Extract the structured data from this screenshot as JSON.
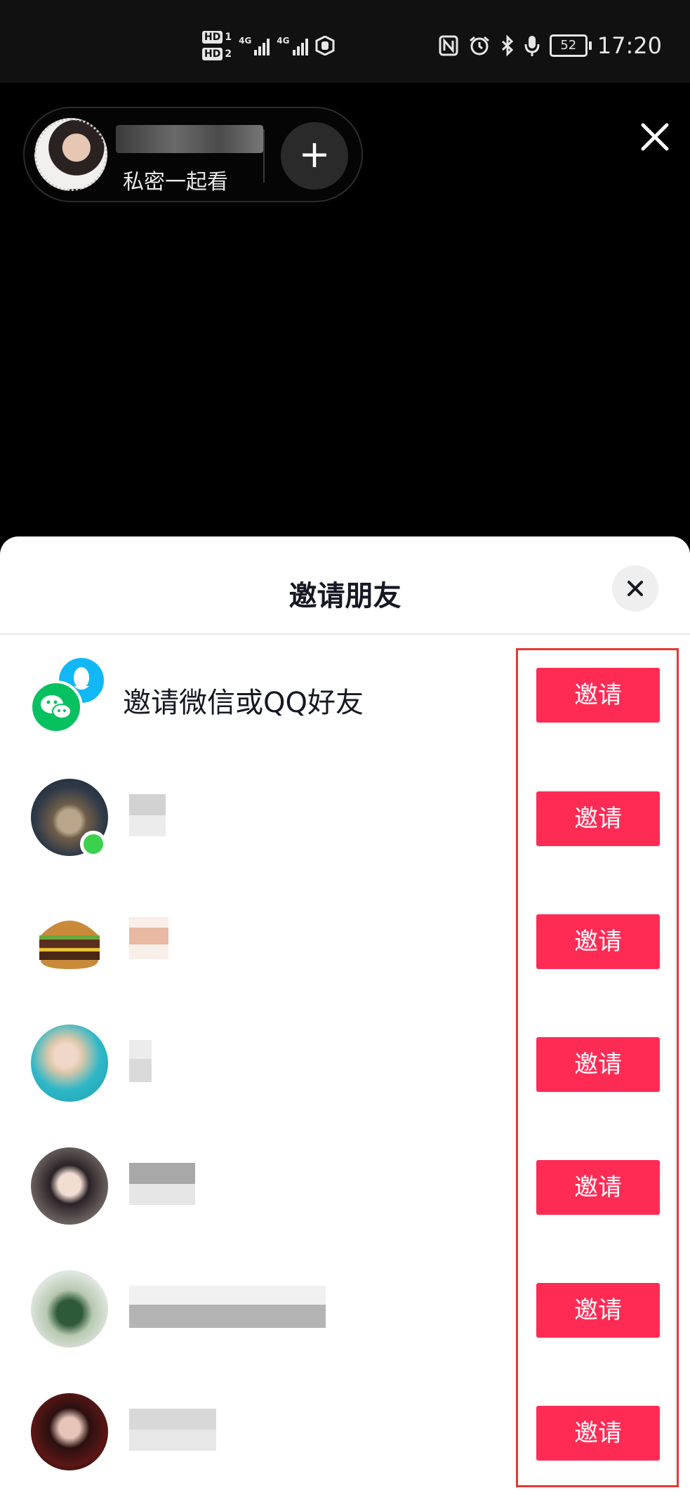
{
  "status_bar": {
    "sim1": "HD",
    "sim1_num": "1",
    "sim2": "HD",
    "sim2_num": "2",
    "network1": "4G",
    "network2": "4G",
    "battery": "52",
    "time": "17:20",
    "icons": [
      "nfc-icon",
      "alarm-icon",
      "bluetooth-icon",
      "microphone-icon"
    ]
  },
  "host": {
    "subtitle": "私密一起看",
    "add_label": "+"
  },
  "sheet": {
    "title": "邀请朋友",
    "invite_wechat_qq_label": "邀请微信或QQ好友",
    "invite_button_label": "邀请",
    "rows": [
      {
        "type": "wechat-qq",
        "button": "邀请"
      },
      {
        "type": "friend",
        "avatar": "cat",
        "online": true,
        "button": "邀请"
      },
      {
        "type": "friend",
        "avatar": "burger",
        "online": false,
        "button": "邀请"
      },
      {
        "type": "friend",
        "avatar": "girl-blonde",
        "online": false,
        "button": "邀请"
      },
      {
        "type": "friend",
        "avatar": "girl-dark-hair",
        "online": false,
        "button": "邀请"
      },
      {
        "type": "friend",
        "avatar": "woman-flowers",
        "online": false,
        "button": "邀请"
      },
      {
        "type": "friend",
        "avatar": "woman-red",
        "online": false,
        "button": "邀请"
      }
    ]
  },
  "colors": {
    "invite_button": "#fe2c55",
    "highlight_box": "#e53935",
    "online_dot": "#3bd14e",
    "wechat_green": "#07c160",
    "qq_blue": "#12b7f5"
  }
}
